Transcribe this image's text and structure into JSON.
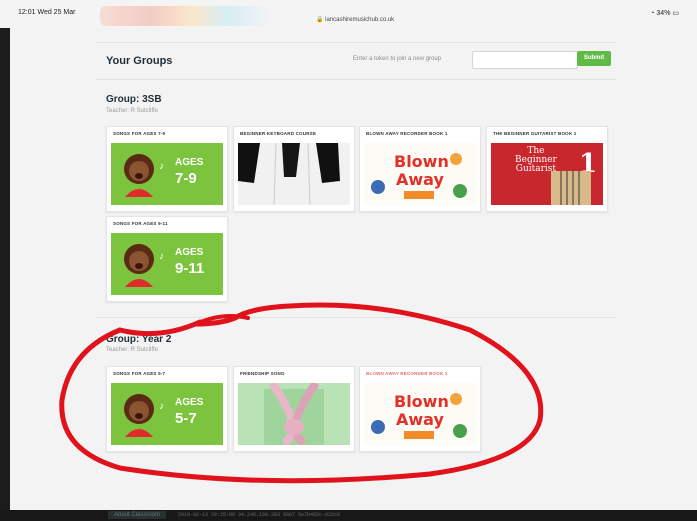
{
  "status": {
    "time": "12:01  Wed 25 Mar",
    "url": "lancashiremusichub.co.uk",
    "battery": "34%"
  },
  "header": {
    "title": "Your Groups",
    "token_label": "Enter a token to join a new group",
    "token_value": "",
    "submit_label": "Submit"
  },
  "groups": [
    {
      "title": "Group: 3SB",
      "teacher": "Teacher: R Sutcliffe",
      "cards": [
        {
          "title": "SONGS FOR AGES 7-9",
          "ages": "AGES",
          "range": "7-9"
        },
        {
          "title": "BEGINNER KEYBOARD COURSE"
        },
        {
          "title": "BLOWN AWAY RECORDER BOOK 1",
          "cover": "Blown Away"
        },
        {
          "title": "THE BEGINNER GUITARIST BOOK 1",
          "cover_line1": "The",
          "cover_line2": "Beginner",
          "cover_line3": "Guitarist",
          "cover_num": "1"
        },
        {
          "title": "SONGS FOR AGES 9-11",
          "ages": "AGES",
          "range": "9-11"
        }
      ]
    },
    {
      "title": "Group: Year 2",
      "teacher": "Teacher: R Sutcliffe",
      "cards": [
        {
          "title": "SONGS FOR AGES 5-7",
          "ages": "AGES",
          "range": "5-7"
        },
        {
          "title": "FRIENDSHIP SONG"
        },
        {
          "title": "BLOWN AWAY RECORDER BOOK 1",
          "cover": "Blown Away"
        }
      ]
    }
  ],
  "footer": {
    "about": "About Classroom",
    "info": "2019-02-13 20:25:00 34.246.190.203 8007 5e7b482c-922c8"
  },
  "colors": {
    "accent_green": "#5fbb46",
    "ages_green": "#7cc43e",
    "annotation_red": "#e0121b"
  }
}
